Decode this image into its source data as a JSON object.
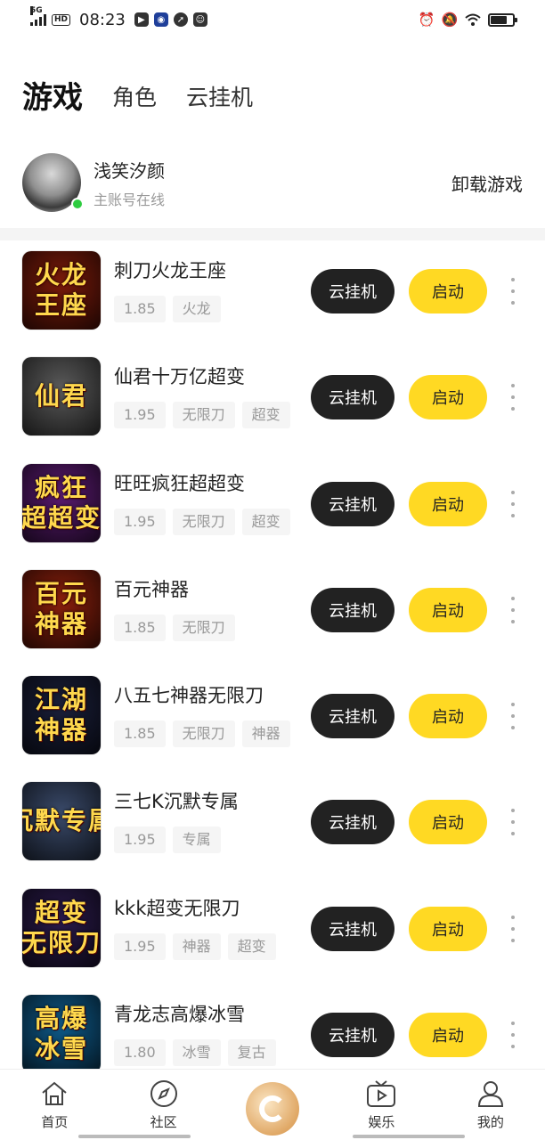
{
  "status_bar": {
    "network": "5G",
    "hd": "HD",
    "time": "08:23"
  },
  "tabs": [
    {
      "label": "游戏",
      "active": true
    },
    {
      "label": "角色",
      "active": false
    },
    {
      "label": "云挂机",
      "active": false
    }
  ],
  "account": {
    "name": "浅笑汐颜",
    "status": "主账号在线",
    "uninstall_label": "卸载游戏"
  },
  "buttons": {
    "cloud": "云挂机",
    "start": "启动"
  },
  "games": [
    {
      "name": "刺刀火龙王座",
      "icon_text": "火龙\n王座",
      "icon_bg": "#7a1a0a",
      "tags": [
        "1.85",
        "火龙"
      ]
    },
    {
      "name": "仙君十万亿超变",
      "icon_text": "仙君",
      "icon_bg": "#5b5b5b",
      "tags": [
        "1.95",
        "无限刀",
        "超变"
      ]
    },
    {
      "name": "旺旺疯狂超超变",
      "icon_text": "疯狂\n超超变",
      "icon_bg": "#5a1a70",
      "tags": [
        "1.95",
        "无限刀",
        "超变"
      ]
    },
    {
      "name": "百元神器",
      "icon_text": "百元\n神器",
      "icon_bg": "#8a1f0c",
      "tags": [
        "1.85",
        "无限刀"
      ]
    },
    {
      "name": "八五七神器无限刀",
      "icon_text": "江湖\n神器",
      "icon_bg": "#1a1f3a",
      "tags": [
        "1.85",
        "无限刀",
        "神器"
      ]
    },
    {
      "name": "三七K沉默专属",
      "icon_text": "沉默专属",
      "icon_bg": "#3a4a6a",
      "tags": [
        "1.95",
        "专属"
      ]
    },
    {
      "name": "kkk超变无限刀",
      "icon_text": "超变\n无限刀",
      "icon_bg": "#2a1a4a",
      "tags": [
        "1.95",
        "神器",
        "超变"
      ]
    },
    {
      "name": "青龙志高爆冰雪",
      "icon_text": "高爆\n冰雪",
      "icon_bg": "#0e5a8a",
      "tags": [
        "1.80",
        "冰雪",
        "复古"
      ]
    }
  ],
  "bottom_nav": [
    {
      "label": "首页",
      "icon": "home-icon"
    },
    {
      "label": "社区",
      "icon": "compass-icon"
    },
    {
      "label": "",
      "icon": "center-logo-icon"
    },
    {
      "label": "娱乐",
      "icon": "tv-play-icon"
    },
    {
      "label": "我的",
      "icon": "user-icon"
    }
  ],
  "colors": {
    "accent_yellow": "#ffd923",
    "dark_button": "#222222",
    "online_green": "#2ecc40"
  }
}
